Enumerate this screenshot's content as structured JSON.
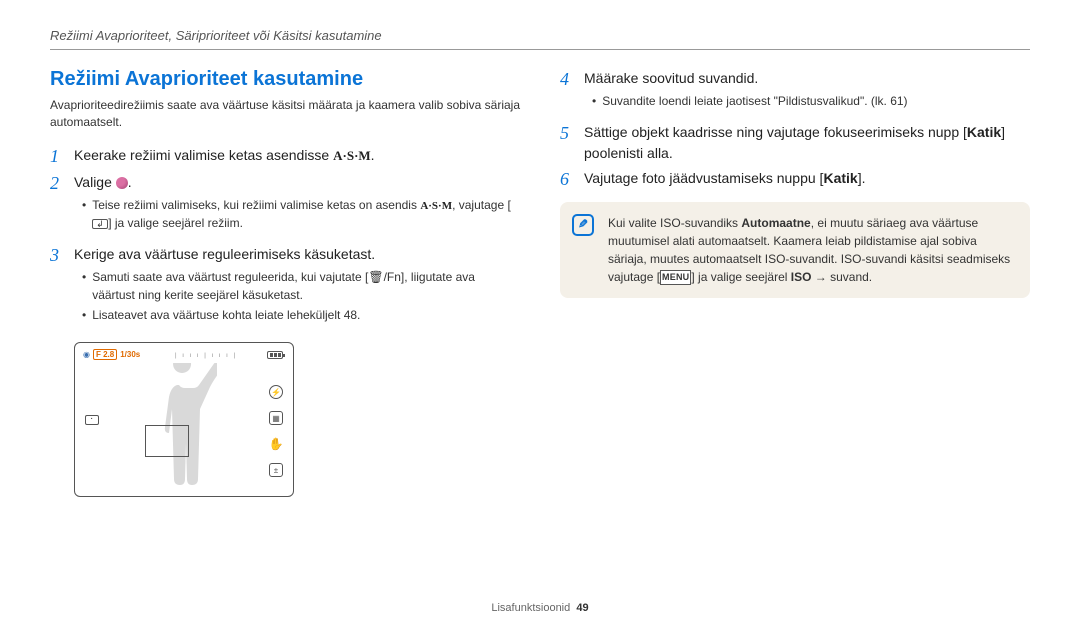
{
  "header": "Režiimi Avaprioriteet, Säriprioriteet või Käsitsi kasutamine",
  "title": "Režiimi Avaprioriteet kasutamine",
  "intro": "Avaprioriteedirežiimis saate ava väärtuse käsitsi määrata ja kaamera valib sobiva säriaja automaatselt.",
  "steps_left": [
    {
      "n": "1",
      "text_before": "Keerake režiimi valimise ketas asendisse ",
      "icon": "asm",
      "text_after": "."
    },
    {
      "n": "2",
      "text_before": "Valige ",
      "icon": "ball",
      "text_after": ".",
      "bullets": [
        {
          "parts": [
            {
              "t": "Teise režiimi valimiseks, kui režiimi valimise ketas on asendis "
            },
            {
              "asm": true
            },
            {
              "t": ", vajutage ["
            },
            {
              "ret": true
            },
            {
              "t": "] ja valige seejärel režiim."
            }
          ]
        }
      ]
    },
    {
      "n": "3",
      "text": "Kerige ava väärtuse reguleerimiseks käsuketast.",
      "bullets": [
        {
          "text": "Samuti saate ava väärtust reguleerida, kui vajutate [🗑/Fn], liigutate ava väärtust ning kerite seejärel käsuketast."
        },
        {
          "text": "Lisateavet ava väärtuse kohta leiate leheküljelt 48."
        }
      ]
    }
  ],
  "steps_right": [
    {
      "n": "4",
      "text": "Määrake soovitud suvandid.",
      "bullets": [
        {
          "text": "Suvandite loendi leiate jaotisest \"Pildistusvalikud\". (lk. 61)"
        }
      ]
    },
    {
      "n": "5",
      "text_before": "Sättige objekt kaadrisse ning vajutage fokuseerimiseks nupp [",
      "bold": "Katik",
      "text_after": "] poolenisti alla."
    },
    {
      "n": "6",
      "text_before": "Vajutage foto jäädvustamiseks nuppu [",
      "bold": "Katik",
      "text_after": "]."
    }
  ],
  "infobox": {
    "before": "Kui valite ISO-suvandiks ",
    "bold1": "Automaatne",
    "middle": ", ei muutu säriaeg ava väärtuse muutumisel alati automaatselt. Kaamera leiab pildistamise ajal sobiva säriaja, muutes automaatselt ISO-suvandit. ISO-suvandi käsitsi seadmiseks vajutage [",
    "menu": "MENU",
    "after_menu": "] ja valige seejärel ",
    "bold2": "ISO",
    "arrow": " → suvand."
  },
  "preview": {
    "badge1": "F 2.8",
    "badge2": "1/30s"
  },
  "footer": {
    "label": "Lisafunktsioonid",
    "page": "49"
  }
}
